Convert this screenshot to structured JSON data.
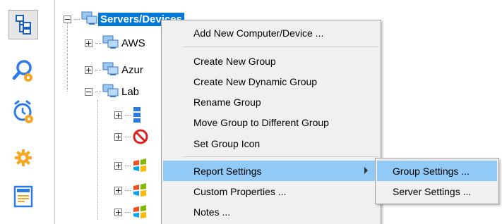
{
  "sidebar": {
    "buttons": [
      {
        "icon": "tree-icon",
        "active": true
      },
      {
        "icon": "magnifier-icon"
      },
      {
        "icon": "alarm-clock-icon"
      },
      {
        "icon": "gear-icon"
      },
      {
        "icon": "news-report-icon"
      }
    ]
  },
  "tree": {
    "root_label": "Servers/Devices",
    "items": [
      {
        "label": "AWS",
        "icon": "computer-group-icon"
      },
      {
        "label": "Azur",
        "icon": "computer-group-icon"
      },
      {
        "label": "Lab",
        "icon": "computer-group-icon"
      }
    ],
    "lab_children": [
      {
        "icon": "server-stack-icon"
      },
      {
        "icon": "no-entry-icon"
      },
      {
        "icon": "windows-logo-icon"
      },
      {
        "icon": "windows-logo-icon"
      },
      {
        "icon": "windows-logo-icon"
      }
    ]
  },
  "context_menu": {
    "add_device": "Add New Computer/Device ...",
    "create_group": "Create New Group",
    "create_dynamic_group": "Create New Dynamic Group",
    "rename_group": "Rename Group",
    "move_group": "Move Group to Different Group",
    "set_group_icon": "Set Group Icon",
    "report_settings": "Report Settings",
    "custom_properties": "Custom Properties ...",
    "notes": "Notes ..."
  },
  "submenu": {
    "group_settings": "Group Settings ...",
    "server_settings": "Server Settings ..."
  },
  "colors": {
    "selection": "#0078d7",
    "menu_highlight": "#91c9f7",
    "menu_background": "#f0f0f0",
    "icon_blue": "#2c7be5",
    "icon_orange": "#f5a623"
  }
}
